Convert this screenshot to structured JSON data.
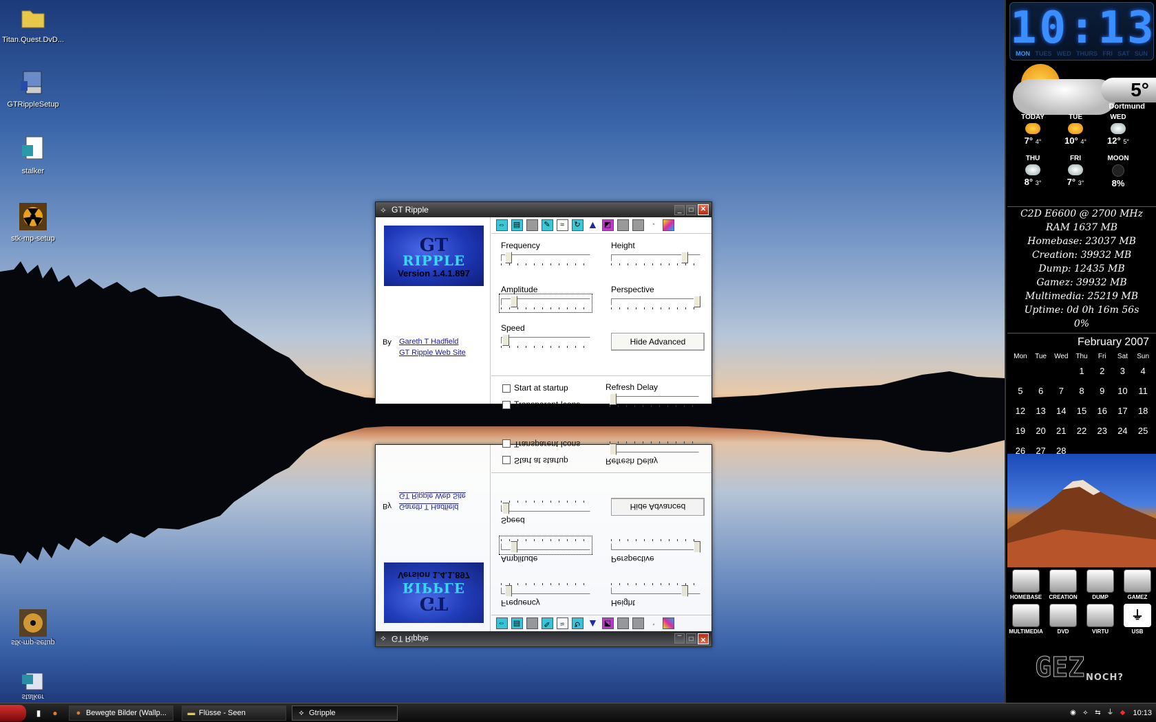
{
  "desktop": {
    "icons": [
      {
        "label": "Titan.Quest.DvD..."
      },
      {
        "label": "GTRippleSetup"
      },
      {
        "label": "stalker"
      },
      {
        "label": "stk-mp-setup"
      }
    ]
  },
  "gt_ripple": {
    "title": "GT Ripple",
    "logo": {
      "line1": "GT",
      "line2": "RIPPLE",
      "version": "Version 1.4.1.897"
    },
    "by_label": "By",
    "author_link": "Gareth T Hadfield",
    "site_link": "GT Ripple Web Site",
    "labels": {
      "frequency": "Frequency",
      "height": "Height",
      "amplitude": "Amplitude",
      "perspective": "Perspective",
      "speed": "Speed",
      "refresh_delay": "Refresh Delay"
    },
    "hide_advanced": "Hide Advanced",
    "start_at_startup": "Start at startup",
    "transparent_icons": "Transparent Icons",
    "sliders": {
      "frequency": 0.05,
      "height": 0.85,
      "amplitude": 0.12,
      "perspective": 1.0,
      "speed": 0.02,
      "refresh_delay": 0.0
    },
    "checkbox_start": false,
    "checkbox_transparent": false,
    "toolbar_icons": [
      "tile-icon",
      "stretch-icon",
      "blank-icon",
      "edit-icon",
      "wave-icon",
      "refresh-icon",
      "arrow-icon",
      "color-icon",
      "gray-icon",
      "gray2-icon",
      "clock-icon",
      "palette-icon"
    ]
  },
  "sidebar": {
    "clock": {
      "time": "10:13",
      "days": [
        "MON",
        "TUES",
        "WED",
        "THURS",
        "FRI",
        "SAT",
        "SUN"
      ],
      "active_day": "MON"
    },
    "weather": {
      "current_temp": "5°",
      "city": "Dortmund",
      "forecast": [
        {
          "day": "TODAY",
          "hi": "7°",
          "lo": "4°",
          "icon": "sun-cloud-icon"
        },
        {
          "day": "TUE",
          "hi": "10°",
          "lo": "4°",
          "icon": "sun-cloud-icon"
        },
        {
          "day": "WED",
          "hi": "12°",
          "lo": "5°",
          "icon": "rain-icon"
        },
        {
          "day": "THU",
          "hi": "8°",
          "lo": "3°",
          "icon": "rain-icon"
        },
        {
          "day": "FRI",
          "hi": "7°",
          "lo": "3°",
          "icon": "rain-icon"
        },
        {
          "day": "MOON",
          "hi": "8%",
          "lo": "",
          "icon": "moon-icon"
        }
      ]
    },
    "system": [
      "C2D E6600 @ 2700 MHz",
      "RAM 1637 MB",
      "Homebase: 23037 MB",
      "Creation: 39932 MB",
      "Dump: 12435 MB",
      "Gamez: 39932 MB",
      "Multimedia: 25219 MB",
      "Uptime: 0d 0h 16m 56s",
      "0%"
    ],
    "calendar": {
      "title": "February 2007",
      "headers": [
        "Mon",
        "Tue",
        "Wed",
        "Thu",
        "Fri",
        "Sat",
        "Sun"
      ],
      "days": [
        "",
        "",
        "",
        "1",
        "2",
        "3",
        "4",
        "5",
        "6",
        "7",
        "8",
        "9",
        "10",
        "11",
        "12",
        "13",
        "14",
        "15",
        "16",
        "17",
        "18",
        "19",
        "20",
        "21",
        "22",
        "23",
        "24",
        "25",
        "26",
        "27",
        "28",
        "",
        "",
        "",
        ""
      ]
    },
    "drives": [
      {
        "label": "HOMEBASE"
      },
      {
        "label": "CREATION"
      },
      {
        "label": "DUMP"
      },
      {
        "label": "GAMEZ"
      },
      {
        "label": "MULTIMEDIA"
      },
      {
        "label": "DVD"
      },
      {
        "label": "VIRTU"
      },
      {
        "label": "USB"
      }
    ],
    "gez": {
      "logo": "GEZ",
      "tagline": "NOCH?"
    }
  },
  "taskbar": {
    "tasks": [
      {
        "label": "Bewegte Bilder (Wallp...",
        "icon": "firefox-icon"
      },
      {
        "label": "Flüsse - Seen",
        "icon": "folder-icon"
      },
      {
        "label": "Gtripple",
        "icon": "gtripple-icon"
      }
    ],
    "time": "10:13"
  }
}
